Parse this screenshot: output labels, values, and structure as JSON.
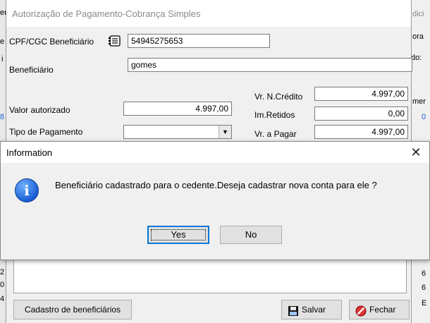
{
  "background_window": {
    "right_labels": [
      "dici",
      "ora",
      "do:",
      "mer",
      "0"
    ],
    "left_labels": [
      "er",
      "e",
      "i",
      "8",
      "2",
      "0",
      "4"
    ],
    "right_digits": [
      "6",
      "6",
      "E"
    ]
  },
  "form": {
    "title": "Autorização de Pagamento-Cobrança Simples",
    "cpf_label": "CPF/CGC Beneficiário",
    "cpf_value": "54945275653",
    "beneficiario_label": "Beneficiário",
    "beneficiario_value": "gomes",
    "valor_autorizado_label": "Valor autorizado",
    "valor_autorizado_value": "4.997,00",
    "tipo_pagamento_label": "Tipo de Pagamento",
    "tipo_pagamento_value": "",
    "vr_ncredito_label": "Vr. N.Crédito",
    "vr_ncredito_value": "4.997,00",
    "im_retidos_label": "Im.Retidos",
    "im_retidos_value": "0,00",
    "vr_pagar_label": "Vr. a Pagar",
    "vr_pagar_value": "4.997,00",
    "cadastro_button": "Cadastro de beneficiários",
    "salvar_button": "Salvar",
    "fechar_button": "Fechar"
  },
  "dialog": {
    "title": "Information",
    "message": "Beneficiário cadastrado para o cedente.Deseja cadastrar nova conta para ele ?",
    "yes_label": "Yes",
    "no_label": "No",
    "close_glyph": "✕",
    "icon_glyph": "i"
  }
}
